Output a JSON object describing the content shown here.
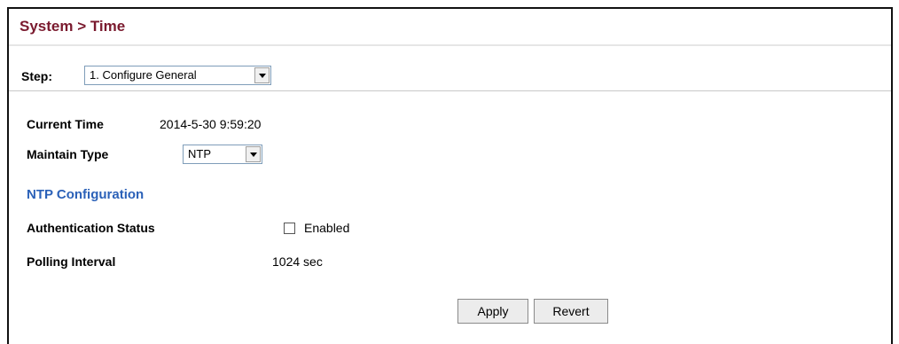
{
  "breadcrumb": "System > Time",
  "step": {
    "label": "Step:",
    "selected": "1. Configure General"
  },
  "fields": {
    "current_time_label": "Current Time",
    "current_time_value": "2014-5-30 9:59:20",
    "maintain_type_label": "Maintain Type",
    "maintain_type_selected": "NTP"
  },
  "ntp": {
    "section_title": "NTP Configuration",
    "auth_status_label": "Authentication Status",
    "auth_enabled_label": "Enabled",
    "auth_enabled_checked": false,
    "polling_interval_label": "Polling Interval",
    "polling_interval_value": "1024 sec"
  },
  "buttons": {
    "apply": "Apply",
    "revert": "Revert"
  }
}
